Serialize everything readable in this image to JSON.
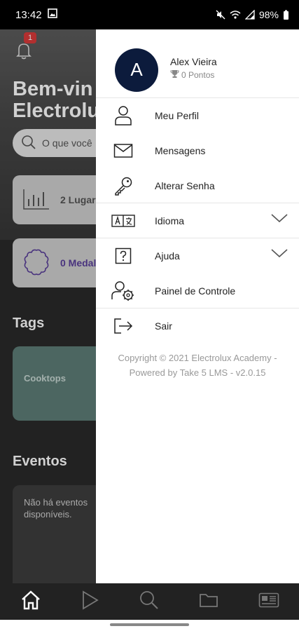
{
  "status_bar": {
    "time": "13:42",
    "battery": "98%"
  },
  "background": {
    "notification_badge": "1",
    "welcome": "Bem-vin\nElectrolu",
    "search_placeholder": "O que você",
    "ranking_card": "2 Lugar",
    "medals_card": "0 Medal",
    "tags_title": "Tags",
    "tag_card": "Cooktops",
    "events_title": "Eventos",
    "events_empty": "Não há eventos\ndisponíveis."
  },
  "drawer": {
    "avatar_initial": "A",
    "user_name": "Alex Vieira",
    "points": "0 Pontos",
    "menu": [
      {
        "label": "Meu Perfil",
        "icon": "user-icon"
      },
      {
        "label": "Mensagens",
        "icon": "envelope-icon"
      },
      {
        "label": "Alterar Senha",
        "icon": "key-icon"
      },
      {
        "label": "Idioma",
        "icon": "translate-icon"
      },
      {
        "label": "Ajuda",
        "icon": "help-icon"
      },
      {
        "label": "Painel de Controle",
        "icon": "user-settings-icon"
      },
      {
        "label": "Sair",
        "icon": "logout-icon"
      }
    ],
    "footer": "Copyright © 2021 Electrolux Academy -\nPowered by Take 5 LMS - v2.0.15"
  },
  "bottom_nav": [
    "home-icon",
    "play-icon",
    "search-icon",
    "folder-icon",
    "news-icon"
  ],
  "colors": {
    "avatar": "#0c1b3c",
    "badge": "#d93a3a",
    "medal": "#5a3f9a"
  }
}
